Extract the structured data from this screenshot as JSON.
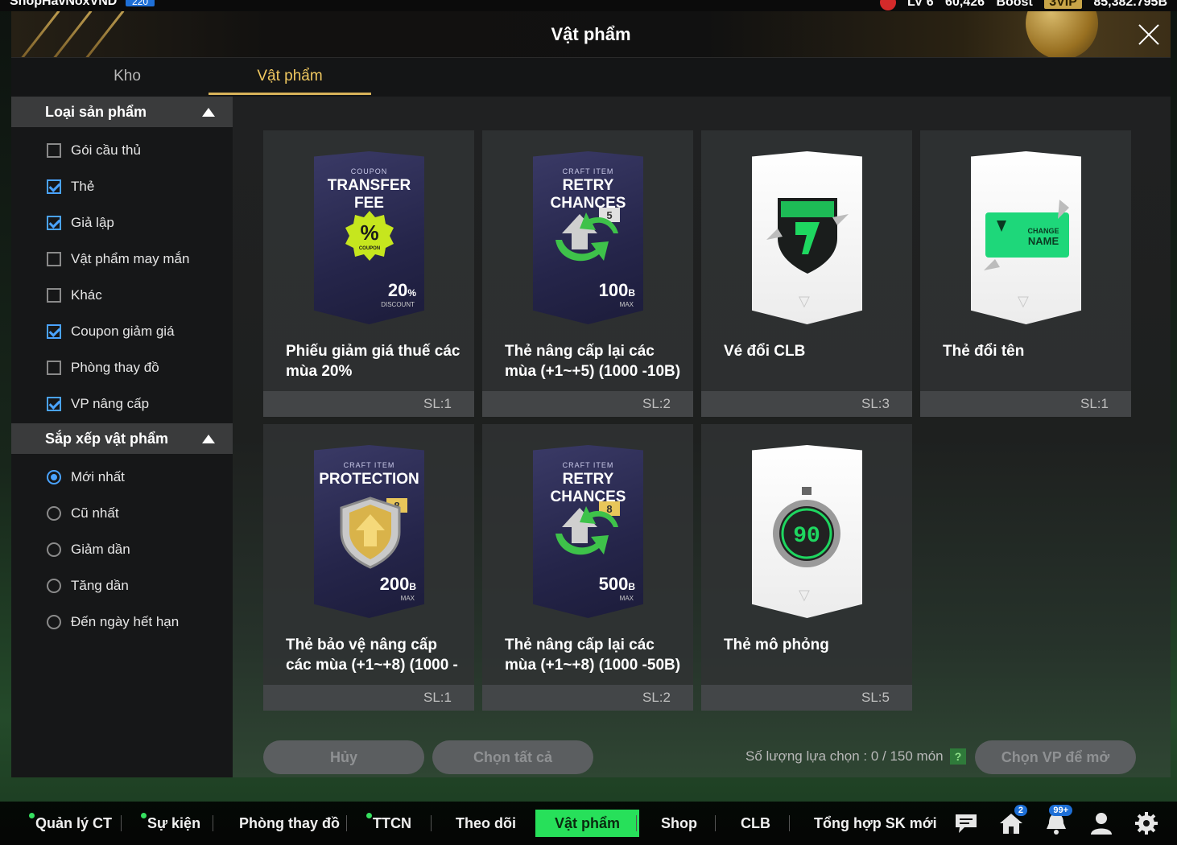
{
  "topbar": {
    "username": "ShopHavNoxVND",
    "level": "220",
    "right_a": "LV 6",
    "right_b": "60,426",
    "right_c": "Boost",
    "vip": "3VIP",
    "right_d": "85,382.795B"
  },
  "window": {
    "title": "Vật phẩm"
  },
  "tabs": [
    {
      "label": "Kho"
    },
    {
      "label": "Vật phẩm"
    }
  ],
  "sidebar": {
    "category_header": "Loại sản phẩm",
    "categories": [
      {
        "label": "Gói cầu thủ",
        "checked": false
      },
      {
        "label": "Thẻ",
        "checked": true
      },
      {
        "label": "Giả lập",
        "checked": true
      },
      {
        "label": "Vật phẩm may mắn",
        "checked": false
      },
      {
        "label": "Khác",
        "checked": false
      },
      {
        "label": "Coupon giảm giá",
        "checked": true
      },
      {
        "label": "Phòng thay đồ",
        "checked": false
      },
      {
        "label": "VP nâng cấp",
        "checked": true
      }
    ],
    "sort_header": "Sắp xếp vật phẩm",
    "sorts": [
      {
        "label": "Mới nhất",
        "selected": true
      },
      {
        "label": "Cũ nhất",
        "selected": false
      },
      {
        "label": "Giảm dần",
        "selected": false
      },
      {
        "label": "Tăng dần",
        "selected": false
      },
      {
        "label": "Đến ngày hết hạn",
        "selected": false
      }
    ]
  },
  "items": [
    {
      "name": "Phiếu giảm giá thuế các mùa 20%",
      "qty": "SL:1",
      "card_small": "COUPON",
      "card_big": "TRANSFER FEE",
      "card_val": "20",
      "card_unit": "%",
      "card_sub": "DISCOUNT",
      "card_badge": "%",
      "card_badge_sub": "COUPON"
    },
    {
      "name": "Thẻ nâng cấp lại các mùa (+1~+5) (1000 -10B)",
      "qty": "SL:2",
      "card_small": "CRAFT ITEM",
      "card_big": "RETRY CHANCES",
      "card_val": "100",
      "card_unit": "B",
      "card_sub": "MAX",
      "card_level": "5"
    },
    {
      "name": "Vé đổi CLB",
      "qty": "SL:3"
    },
    {
      "name": "Thẻ đổi tên",
      "qty": "SL:1",
      "card_text_a": "CHANGE",
      "card_text_b": "NAME"
    },
    {
      "name": "Thẻ bảo vệ nâng cấp các mùa (+1~+8) (1000 -",
      "qty": "SL:1",
      "card_small": "CRAFT ITEM",
      "card_big": "PROTECTION",
      "card_val": "200",
      "card_unit": "B",
      "card_sub": "MAX",
      "card_level": "8"
    },
    {
      "name": "Thẻ nâng cấp lại các mùa (+1~+8) (1000 -50B)",
      "qty": "SL:2",
      "card_small": "CRAFT ITEM",
      "card_big": "RETRY CHANCES",
      "card_val": "500",
      "card_unit": "B",
      "card_sub": "MAX",
      "card_level": "8"
    },
    {
      "name": "Thẻ mô phỏng",
      "qty": "SL:5",
      "card_timer": "90"
    }
  ],
  "footer": {
    "cancel_label": "Hủy",
    "select_all_label": "Chọn tất cả",
    "selection_count": "Số lượng lựa chọn : 0 / 150 món",
    "help": "?",
    "open_label": "Chọn VP để mở"
  },
  "bottom_nav": [
    {
      "label": "Quản lý CT",
      "dot": true
    },
    {
      "label": "Sự kiện",
      "dot": true
    },
    {
      "label": "Phòng thay đồ",
      "dot": false
    },
    {
      "label": "TTCN",
      "dot": true
    },
    {
      "label": "Theo dõi",
      "dot": false
    },
    {
      "label": "Vật phẩm",
      "dot": false,
      "active": true
    },
    {
      "label": "Shop",
      "dot": false
    },
    {
      "label": "CLB",
      "dot": false
    },
    {
      "label": "Tổng hợp SK mới",
      "dot": false
    }
  ],
  "bottom_icons": {
    "chat": "chat-icon",
    "home": "home-icon",
    "home_badge": "2",
    "bell": "bell-icon",
    "bell_badge": "99+",
    "profile": "profile-icon",
    "settings": "gear-icon"
  },
  "colors": {
    "accent_gold": "#d8b35a",
    "active_green": "#27e05a",
    "checkbox_blue": "#4aa3ff"
  }
}
